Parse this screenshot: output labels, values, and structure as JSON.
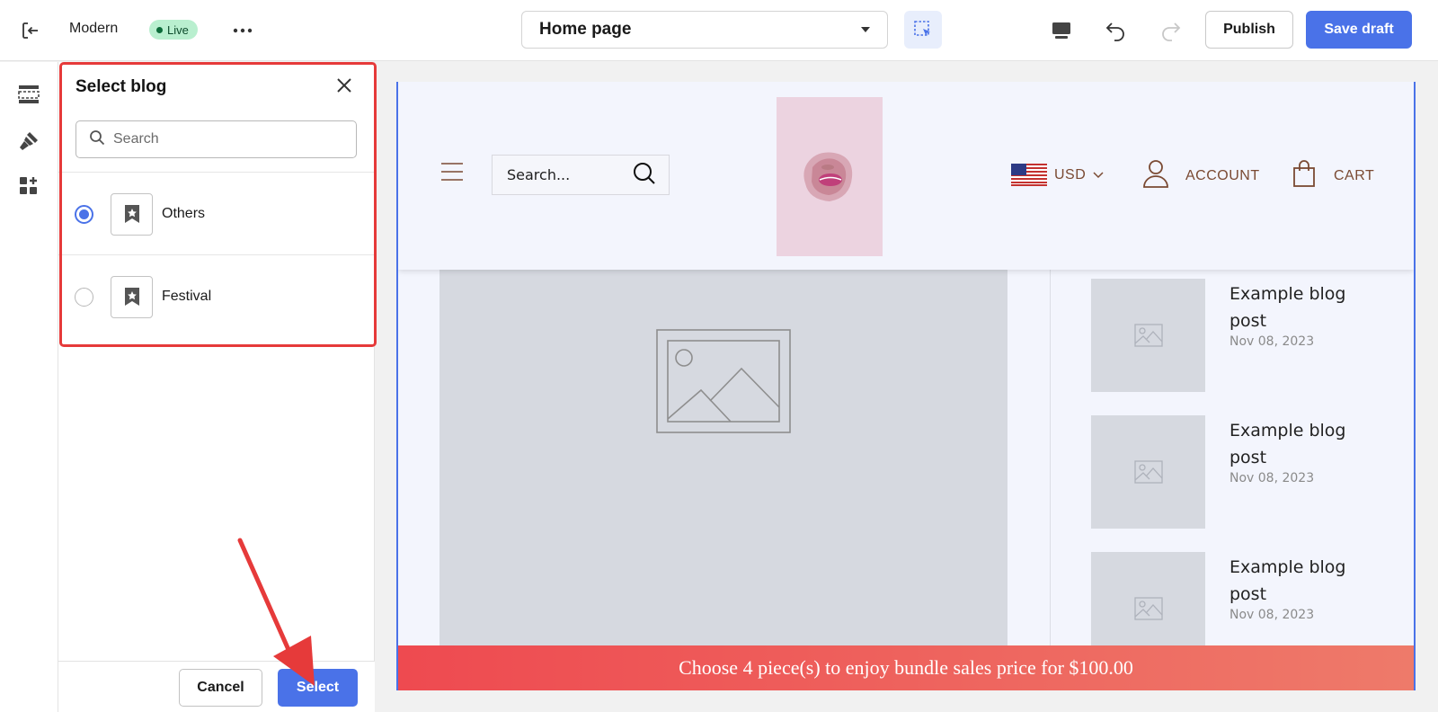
{
  "topbar": {
    "theme_name": "Modern",
    "status_badge": "Live",
    "page_selector": {
      "selected": "Home page"
    },
    "publish_label": "Publish",
    "save_draft_label": "Save draft",
    "colors": {
      "accent": "#4a72e8",
      "live_bg": "#b9efcf"
    }
  },
  "rail": {
    "items": [
      {
        "icon": "sections-icon"
      },
      {
        "icon": "theme-settings-icon"
      },
      {
        "icon": "apps-icon"
      }
    ]
  },
  "panel": {
    "title": "Select blog",
    "search": {
      "placeholder": "Search",
      "value": ""
    },
    "options": [
      {
        "label": "Others",
        "selected": true,
        "icon": "bookmark-star-icon"
      },
      {
        "label": "Festival",
        "selected": false,
        "icon": "bookmark-star-icon"
      }
    ],
    "cancel_label": "Cancel",
    "select_label": "Select"
  },
  "preview": {
    "header": {
      "search_placeholder": "Search...",
      "currency": "USD",
      "account_label": "ACCOUNT",
      "cart_label": "CART"
    },
    "posts": [
      {
        "title": "Example blog post",
        "date": "Nov 08, 2023"
      },
      {
        "title": "Example blog post",
        "date": "Nov 08, 2023"
      },
      {
        "title": "Example blog post",
        "date": "Nov 08, 2023"
      }
    ],
    "promo_text": "Choose 4 piece(s) to enjoy bundle sales price for $100.00"
  }
}
